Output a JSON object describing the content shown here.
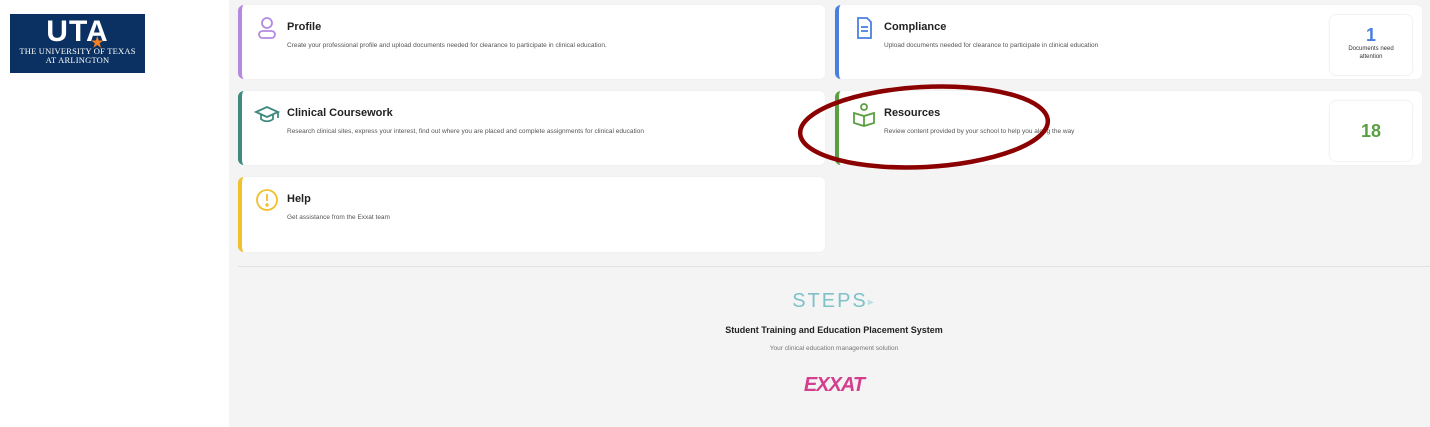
{
  "branding": {
    "logo_mark": "UTA",
    "logo_line1": "THE UNIVERSITY OF TEXAS",
    "logo_line2": "AT ARLINGTON",
    "logo_color": "#0a3161",
    "star_color": "#f58025"
  },
  "cards": {
    "profile": {
      "title": "Profile",
      "description": "Create your professional profile and upload documents needed for clearance to participate in clinical education.",
      "icon": "user-icon",
      "accent": "#b48ae0"
    },
    "compliance": {
      "title": "Compliance",
      "description": "Upload documents needed for clearance to participate in clinical education",
      "icon": "document-icon",
      "accent": "#4a7fe0",
      "counter_value": "1",
      "counter_label": "Documents need attention"
    },
    "coursework": {
      "title": "Clinical Coursework",
      "description": "Research clinical sites, express your interest, find out where you are placed and complete assignments for clinical education",
      "icon": "graduation-cap-icon",
      "accent": "#3f8a7e"
    },
    "resources": {
      "title": "Resources",
      "description": "Review content provided by your school to help you along the way",
      "icon": "book-person-icon",
      "accent": "#5aa040",
      "counter_value": "18"
    },
    "help": {
      "title": "Help",
      "description": "Get assistance from the Exxat team",
      "icon": "exclamation-circle-icon",
      "accent": "#f0c02d"
    }
  },
  "footer": {
    "steps_logo": "STEPS",
    "title": "Student Training and Education Placement System",
    "tagline": "Your clinical education management solution",
    "exxat_logo": "EXXAT",
    "exxat_color": "#d43f8d"
  },
  "annotation": {
    "ellipse_color": "#8b0000"
  }
}
